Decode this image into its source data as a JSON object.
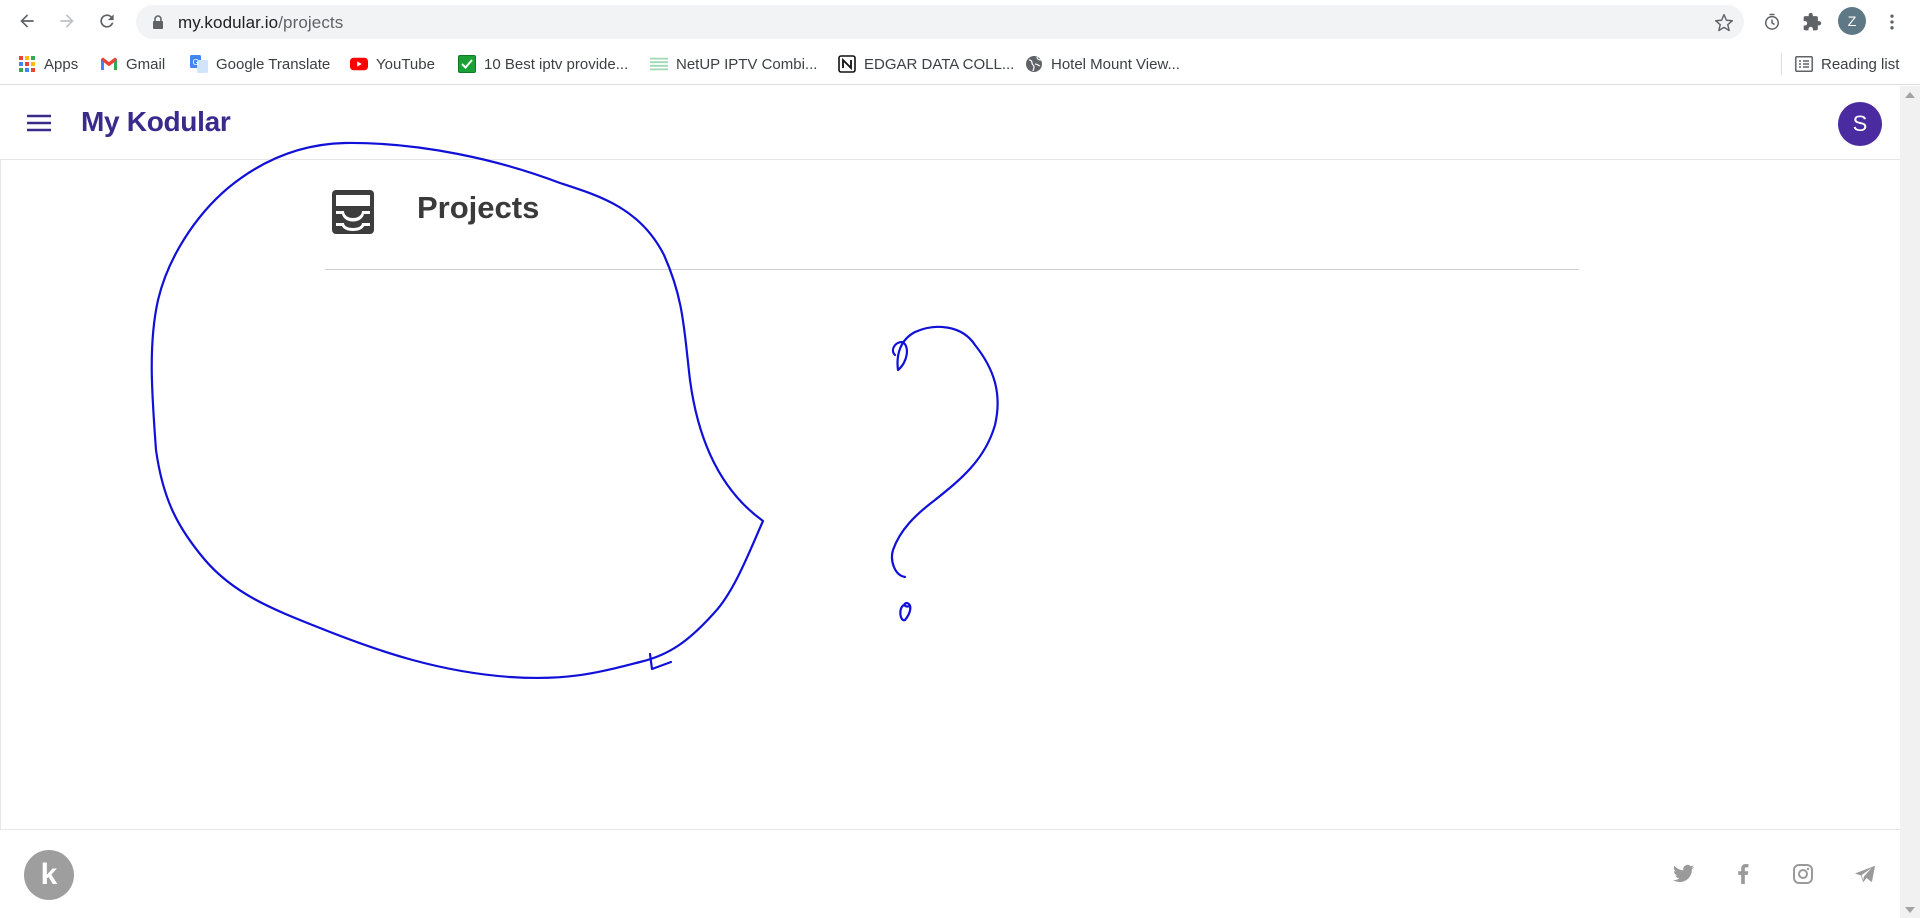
{
  "browser": {
    "url_host": "my.kodular.io",
    "url_path": "/projects",
    "profile_initial": "Z",
    "bookmarks": [
      {
        "label": "Apps",
        "icon": "apps-grid-icon"
      },
      {
        "label": "Gmail",
        "icon": "gmail-icon"
      },
      {
        "label": "Google Translate",
        "icon": "google-translate-icon"
      },
      {
        "label": "YouTube",
        "icon": "youtube-icon"
      },
      {
        "label": "10 Best iptv provide...",
        "icon": "checkbox-icon"
      },
      {
        "label": "NetUP IPTV Combi...",
        "icon": "netup-icon"
      },
      {
        "label": "EDGAR DATA COLL...",
        "icon": "notion-icon"
      },
      {
        "label": "Hotel Mount View...",
        "icon": "globe-icon"
      }
    ],
    "reading_list_label": "Reading list"
  },
  "app": {
    "brand": "My Kodular",
    "avatar_initial": "S",
    "page_title": "Projects",
    "brand_color": "#3a2a8c",
    "avatar_color": "#4b2ca0"
  },
  "footer": {
    "logo_letter": "k",
    "social_icons": [
      "twitter-icon",
      "facebook-icon",
      "instagram-icon",
      "telegram-icon"
    ]
  },
  "annotation": {
    "ink_color": "#1010d8"
  }
}
